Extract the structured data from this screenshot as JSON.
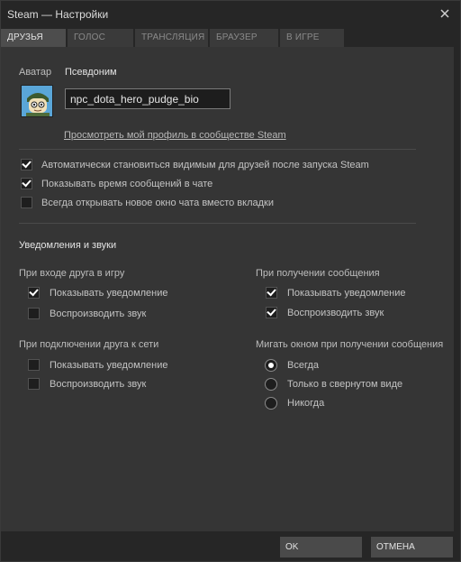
{
  "window": {
    "title": "Steam — Настройки",
    "close_icon": "close-icon"
  },
  "tabs": [
    {
      "label": "ДРУЗЬЯ",
      "active": true
    },
    {
      "label": "ГОЛОС",
      "active": false
    },
    {
      "label": "ТРАНСЛЯЦИЯ",
      "active": false
    },
    {
      "label": "БРАУЗЕР",
      "active": false
    },
    {
      "label": "В ИГРЕ",
      "active": false
    }
  ],
  "profile": {
    "avatar_label": "Аватар",
    "nickname_label": "Псевдоним",
    "nickname_value": "npc_dota_hero_pudge_bio",
    "profile_link": "Просмотреть мой профиль в сообществе Steam"
  },
  "general_options": [
    {
      "label": "Автоматически становиться видимым для друзей после запуска Steam",
      "checked": true
    },
    {
      "label": "Показывать время сообщений в чате",
      "checked": true
    },
    {
      "label": "Всегда открывать новое окно чата вместо вкладки",
      "checked": false
    }
  ],
  "notifications": {
    "heading": "Уведомления и звуки",
    "friend_joins_game": {
      "heading": "При входе друга в игру",
      "show_notification": {
        "label": "Показывать уведомление",
        "checked": true
      },
      "play_sound": {
        "label": "Воспроизводить звук",
        "checked": false
      }
    },
    "message_received": {
      "heading": "При получении сообщения",
      "show_notification": {
        "label": "Показывать уведомление",
        "checked": true
      },
      "play_sound": {
        "label": "Воспроизводить звук",
        "checked": true
      }
    },
    "friend_online": {
      "heading": "При подключении друга к сети",
      "show_notification": {
        "label": "Показывать уведомление",
        "checked": false
      },
      "play_sound": {
        "label": "Воспроизводить звук",
        "checked": false
      }
    },
    "flash_window": {
      "heading": "Мигать окном при получении сообщения",
      "options": [
        {
          "label": "Всегда",
          "selected": true
        },
        {
          "label": "Только в свернутом виде",
          "selected": false
        },
        {
          "label": "Никогда",
          "selected": false
        }
      ]
    }
  },
  "footer": {
    "ok_label": "OK",
    "cancel_label": "ОТМЕНА"
  },
  "colors": {
    "background": "#262626",
    "panel": "#353535",
    "tab_active": "#4d4d4d",
    "tab_inactive": "#3a3a3a",
    "button": "#4a4a4a",
    "avatar_bg": "#5aa6d8"
  }
}
